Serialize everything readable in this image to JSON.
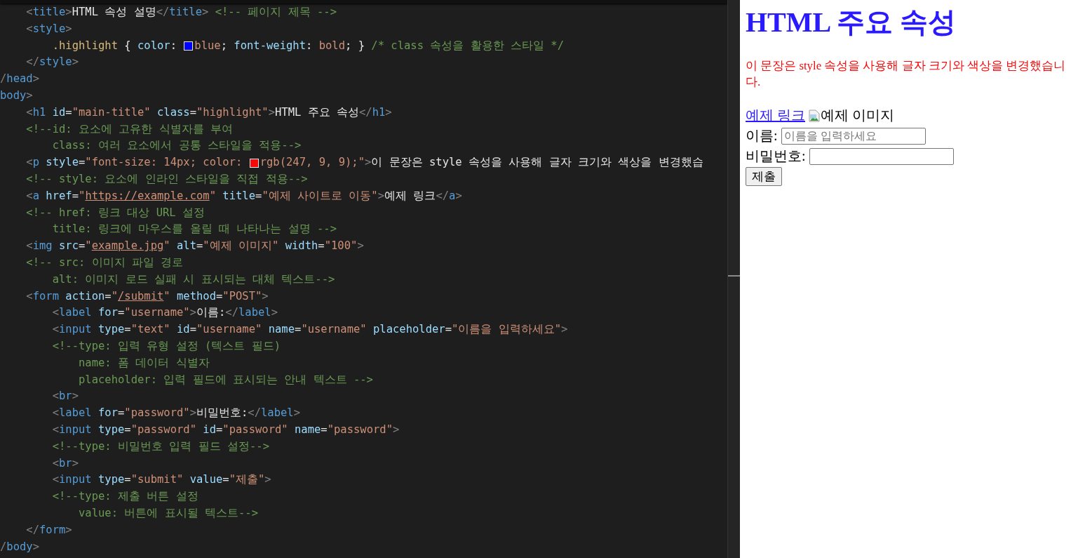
{
  "editor": {
    "lines": [
      {
        "tokens": [
          {
            "kind": "punct",
            "text": "    <"
          },
          {
            "kind": "tag",
            "text": "title"
          },
          {
            "kind": "punct",
            "text": ">"
          },
          {
            "kind": "text",
            "text": "HTML 속성 설명"
          },
          {
            "kind": "punct",
            "text": "</"
          },
          {
            "kind": "tag",
            "text": "title"
          },
          {
            "kind": "punct",
            "text": ">"
          },
          {
            "kind": "comment",
            "text": " <!-- 페이지 제목 -->"
          }
        ]
      },
      {
        "tokens": [
          {
            "kind": "punct",
            "text": "    <"
          },
          {
            "kind": "tag",
            "text": "style"
          },
          {
            "kind": "punct",
            "text": ">"
          }
        ]
      },
      {
        "tokens": [
          {
            "kind": "selector",
            "text": "        .highlight"
          },
          {
            "kind": "text",
            "text": " { "
          },
          {
            "kind": "property",
            "text": "color"
          },
          {
            "kind": "text",
            "text": ": "
          },
          {
            "kind": "swatch",
            "color": "#0000ff"
          },
          {
            "kind": "value",
            "text": "blue"
          },
          {
            "kind": "text",
            "text": "; "
          },
          {
            "kind": "property",
            "text": "font-weight"
          },
          {
            "kind": "text",
            "text": ": "
          },
          {
            "kind": "value",
            "text": "bold"
          },
          {
            "kind": "text",
            "text": "; } "
          },
          {
            "kind": "comment",
            "text": "/* class 속성을 활용한 스타일 */"
          }
        ]
      },
      {
        "tokens": [
          {
            "kind": "punct",
            "text": "    </"
          },
          {
            "kind": "tag",
            "text": "style"
          },
          {
            "kind": "punct",
            "text": ">"
          }
        ]
      },
      {
        "tokens": [
          {
            "kind": "punct",
            "text": "/"
          },
          {
            "kind": "tag",
            "text": "head"
          },
          {
            "kind": "punct",
            "text": ">"
          }
        ]
      },
      {
        "tokens": [
          {
            "kind": "tag",
            "text": "body"
          },
          {
            "kind": "punct",
            "text": ">"
          }
        ]
      },
      {
        "tokens": [
          {
            "kind": "punct",
            "text": "    <"
          },
          {
            "kind": "tag",
            "text": "h1"
          },
          {
            "kind": "attr",
            "text": " id"
          },
          {
            "kind": "text",
            "text": "="
          },
          {
            "kind": "string",
            "text": "\"main-title\""
          },
          {
            "kind": "attr",
            "text": " class"
          },
          {
            "kind": "text",
            "text": "="
          },
          {
            "kind": "string",
            "text": "\"highlight\""
          },
          {
            "kind": "punct",
            "text": ">"
          },
          {
            "kind": "text",
            "text": "HTML 주요 속성"
          },
          {
            "kind": "punct",
            "text": "</"
          },
          {
            "kind": "tag",
            "text": "h1"
          },
          {
            "kind": "punct",
            "text": ">"
          }
        ]
      },
      {
        "tokens": [
          {
            "kind": "comment",
            "text": "    <!--id: 요소에 고유한 식별자를 부여"
          }
        ]
      },
      {
        "tokens": [
          {
            "kind": "comment",
            "text": "        class: 여러 요소에서 공통 스타일을 적용-->"
          }
        ]
      },
      {
        "tokens": [
          {
            "kind": "punct",
            "text": "    <"
          },
          {
            "kind": "tag",
            "text": "p"
          },
          {
            "kind": "attr",
            "text": " style"
          },
          {
            "kind": "text",
            "text": "="
          },
          {
            "kind": "string",
            "text": "\"font-size: 14px; color: "
          },
          {
            "kind": "swatch",
            "color": "#f70909"
          },
          {
            "kind": "string",
            "text": "rgb(247, 9, 9);\""
          },
          {
            "kind": "punct",
            "text": ">"
          },
          {
            "kind": "text",
            "text": "이 문장은 style 속성을 사용해 글자 크기와 색상을 변경했습"
          }
        ]
      },
      {
        "tokens": [
          {
            "kind": "comment",
            "text": "    <!-- style: 요소에 인라인 스타일을 직접 적용-->"
          }
        ]
      },
      {
        "tokens": [
          {
            "kind": "punct",
            "text": "    <"
          },
          {
            "kind": "tag",
            "text": "a"
          },
          {
            "kind": "attr",
            "text": " href"
          },
          {
            "kind": "text",
            "text": "="
          },
          {
            "kind": "string",
            "text": "\""
          },
          {
            "kind": "link",
            "text": "https://example.com"
          },
          {
            "kind": "string",
            "text": "\""
          },
          {
            "kind": "attr",
            "text": " title"
          },
          {
            "kind": "text",
            "text": "="
          },
          {
            "kind": "string",
            "text": "\"예제 사이트로 이동\""
          },
          {
            "kind": "punct",
            "text": ">"
          },
          {
            "kind": "text",
            "text": "예제 링크"
          },
          {
            "kind": "punct",
            "text": "</"
          },
          {
            "kind": "tag",
            "text": "a"
          },
          {
            "kind": "punct",
            "text": ">"
          }
        ]
      },
      {
        "tokens": [
          {
            "kind": "comment",
            "text": "    <!-- href: 링크 대상 URL 설정"
          }
        ]
      },
      {
        "tokens": [
          {
            "kind": "comment",
            "text": "        title: 링크에 마우스를 올릴 때 나타나는 설명 -->"
          }
        ]
      },
      {
        "tokens": [
          {
            "kind": "punct",
            "text": "    <"
          },
          {
            "kind": "tag",
            "text": "img"
          },
          {
            "kind": "attr",
            "text": " src"
          },
          {
            "kind": "text",
            "text": "="
          },
          {
            "kind": "string",
            "text": "\""
          },
          {
            "kind": "link",
            "text": "example.jpg"
          },
          {
            "kind": "string",
            "text": "\""
          },
          {
            "kind": "attr",
            "text": " alt"
          },
          {
            "kind": "text",
            "text": "="
          },
          {
            "kind": "string",
            "text": "\"예제 이미지\""
          },
          {
            "kind": "attr",
            "text": " width"
          },
          {
            "kind": "text",
            "text": "="
          },
          {
            "kind": "string",
            "text": "\"100\""
          },
          {
            "kind": "punct",
            "text": ">"
          }
        ]
      },
      {
        "tokens": [
          {
            "kind": "comment",
            "text": "    <!-- src: 이미지 파일 경로"
          }
        ]
      },
      {
        "tokens": [
          {
            "kind": "comment",
            "text": "        alt: 이미지 로드 실패 시 표시되는 대체 텍스트-->"
          }
        ]
      },
      {
        "tokens": [
          {
            "kind": "punct",
            "text": "    <"
          },
          {
            "kind": "tag",
            "text": "form"
          },
          {
            "kind": "attr",
            "text": " action"
          },
          {
            "kind": "text",
            "text": "="
          },
          {
            "kind": "string",
            "text": "\""
          },
          {
            "kind": "link",
            "text": "/submit"
          },
          {
            "kind": "string",
            "text": "\""
          },
          {
            "kind": "attr",
            "text": " method"
          },
          {
            "kind": "text",
            "text": "="
          },
          {
            "kind": "string",
            "text": "\"POST\""
          },
          {
            "kind": "punct",
            "text": ">"
          }
        ]
      },
      {
        "tokens": [
          {
            "kind": "punct",
            "text": "        <"
          },
          {
            "kind": "tag",
            "text": "label"
          },
          {
            "kind": "attr",
            "text": " for"
          },
          {
            "kind": "text",
            "text": "="
          },
          {
            "kind": "string",
            "text": "\"username\""
          },
          {
            "kind": "punct",
            "text": ">"
          },
          {
            "kind": "text",
            "text": "이름:"
          },
          {
            "kind": "punct",
            "text": "</"
          },
          {
            "kind": "tag",
            "text": "label"
          },
          {
            "kind": "punct",
            "text": ">"
          }
        ]
      },
      {
        "tokens": [
          {
            "kind": "punct",
            "text": "        <"
          },
          {
            "kind": "tag",
            "text": "input"
          },
          {
            "kind": "attr",
            "text": " type"
          },
          {
            "kind": "text",
            "text": "="
          },
          {
            "kind": "string",
            "text": "\"text\""
          },
          {
            "kind": "attr",
            "text": " id"
          },
          {
            "kind": "text",
            "text": "="
          },
          {
            "kind": "string",
            "text": "\"username\""
          },
          {
            "kind": "attr",
            "text": " name"
          },
          {
            "kind": "text",
            "text": "="
          },
          {
            "kind": "string",
            "text": "\"username\""
          },
          {
            "kind": "attr",
            "text": " placeholder"
          },
          {
            "kind": "text",
            "text": "="
          },
          {
            "kind": "string",
            "text": "\"이름을 입력하세요\""
          },
          {
            "kind": "punct",
            "text": ">"
          }
        ]
      },
      {
        "tokens": [
          {
            "kind": "comment",
            "text": "        <!--type: 입력 유형 설정 (텍스트 필드)"
          }
        ]
      },
      {
        "tokens": [
          {
            "kind": "comment",
            "text": "            name: 폼 데이터 식별자"
          }
        ]
      },
      {
        "tokens": [
          {
            "kind": "comment",
            "text": "            placeholder: 입력 필드에 표시되는 안내 텍스트 -->"
          }
        ]
      },
      {
        "tokens": [
          {
            "kind": "punct",
            "text": "        <"
          },
          {
            "kind": "tag",
            "text": "br"
          },
          {
            "kind": "punct",
            "text": ">"
          }
        ]
      },
      {
        "tokens": [
          {
            "kind": "punct",
            "text": "        <"
          },
          {
            "kind": "tag",
            "text": "label"
          },
          {
            "kind": "attr",
            "text": " for"
          },
          {
            "kind": "text",
            "text": "="
          },
          {
            "kind": "string",
            "text": "\"password\""
          },
          {
            "kind": "punct",
            "text": ">"
          },
          {
            "kind": "text",
            "text": "비밀번호:"
          },
          {
            "kind": "punct",
            "text": "</"
          },
          {
            "kind": "tag",
            "text": "label"
          },
          {
            "kind": "punct",
            "text": ">"
          }
        ]
      },
      {
        "tokens": [
          {
            "kind": "punct",
            "text": "        <"
          },
          {
            "kind": "tag",
            "text": "input"
          },
          {
            "kind": "attr",
            "text": " type"
          },
          {
            "kind": "text",
            "text": "="
          },
          {
            "kind": "string",
            "text": "\"password\""
          },
          {
            "kind": "attr",
            "text": " id"
          },
          {
            "kind": "text",
            "text": "="
          },
          {
            "kind": "string",
            "text": "\"password\""
          },
          {
            "kind": "attr",
            "text": " name"
          },
          {
            "kind": "text",
            "text": "="
          },
          {
            "kind": "string",
            "text": "\"password\""
          },
          {
            "kind": "punct",
            "text": ">"
          }
        ]
      },
      {
        "tokens": [
          {
            "kind": "comment",
            "text": "        <!--type: 비밀번호 입력 필드 설정-->"
          }
        ]
      },
      {
        "tokens": [
          {
            "kind": "punct",
            "text": "        <"
          },
          {
            "kind": "tag",
            "text": "br"
          },
          {
            "kind": "punct",
            "text": ">"
          }
        ]
      },
      {
        "tokens": [
          {
            "kind": "punct",
            "text": "        <"
          },
          {
            "kind": "tag",
            "text": "input"
          },
          {
            "kind": "attr",
            "text": " type"
          },
          {
            "kind": "text",
            "text": "="
          },
          {
            "kind": "string",
            "text": "\"submit\""
          },
          {
            "kind": "attr",
            "text": " value"
          },
          {
            "kind": "text",
            "text": "="
          },
          {
            "kind": "string",
            "text": "\"제출\""
          },
          {
            "kind": "punct",
            "text": ">"
          }
        ]
      },
      {
        "tokens": [
          {
            "kind": "comment",
            "text": "        <!--type: 제출 버튼 설정"
          }
        ]
      },
      {
        "tokens": [
          {
            "kind": "comment",
            "text": "            value: 버튼에 표시될 텍스트-->"
          }
        ]
      },
      {
        "tokens": [
          {
            "kind": "punct",
            "text": "    </"
          },
          {
            "kind": "tag",
            "text": "form"
          },
          {
            "kind": "punct",
            "text": ">"
          }
        ]
      },
      {
        "tokens": [
          {
            "kind": "punct",
            "text": "/"
          },
          {
            "kind": "tag",
            "text": "body"
          },
          {
            "kind": "punct",
            "text": ">"
          }
        ]
      }
    ]
  },
  "preview": {
    "heading": "HTML 주요 속성",
    "paragraph": "이 문장은 style 속성을 사용해 글자 크기와 색상을 변경했습니다.",
    "link": "예제 링크",
    "image_alt": "예제 이미지",
    "fields": [
      {
        "label": "이름:",
        "placeholder": "이름을 입력하세요"
      },
      {
        "label": "비밀번호:"
      }
    ],
    "submit": "제출"
  }
}
